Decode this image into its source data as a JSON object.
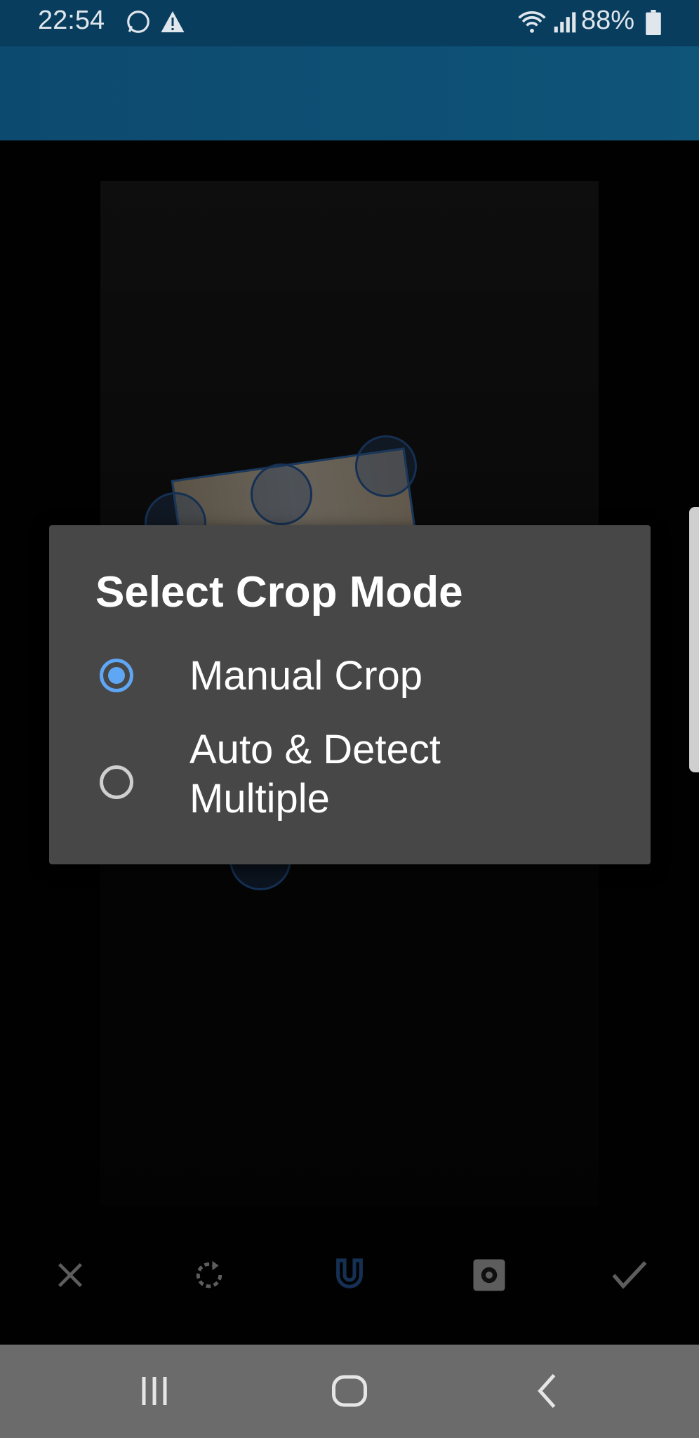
{
  "status": {
    "time": "22:54",
    "battery": "88%"
  },
  "dialog": {
    "title": "Select Crop Mode",
    "options": [
      {
        "label": "Manual Crop",
        "selected": true
      },
      {
        "label": "Auto & Detect Multiple",
        "selected": false
      }
    ]
  },
  "toolbar": [
    "close-icon",
    "rotate-icon",
    "magnet-icon",
    "settings-icon",
    "check-icon"
  ],
  "colors": {
    "accent": "#5fa6f4",
    "dialog_bg": "#474747",
    "app_bar": "#0d4a6f"
  }
}
